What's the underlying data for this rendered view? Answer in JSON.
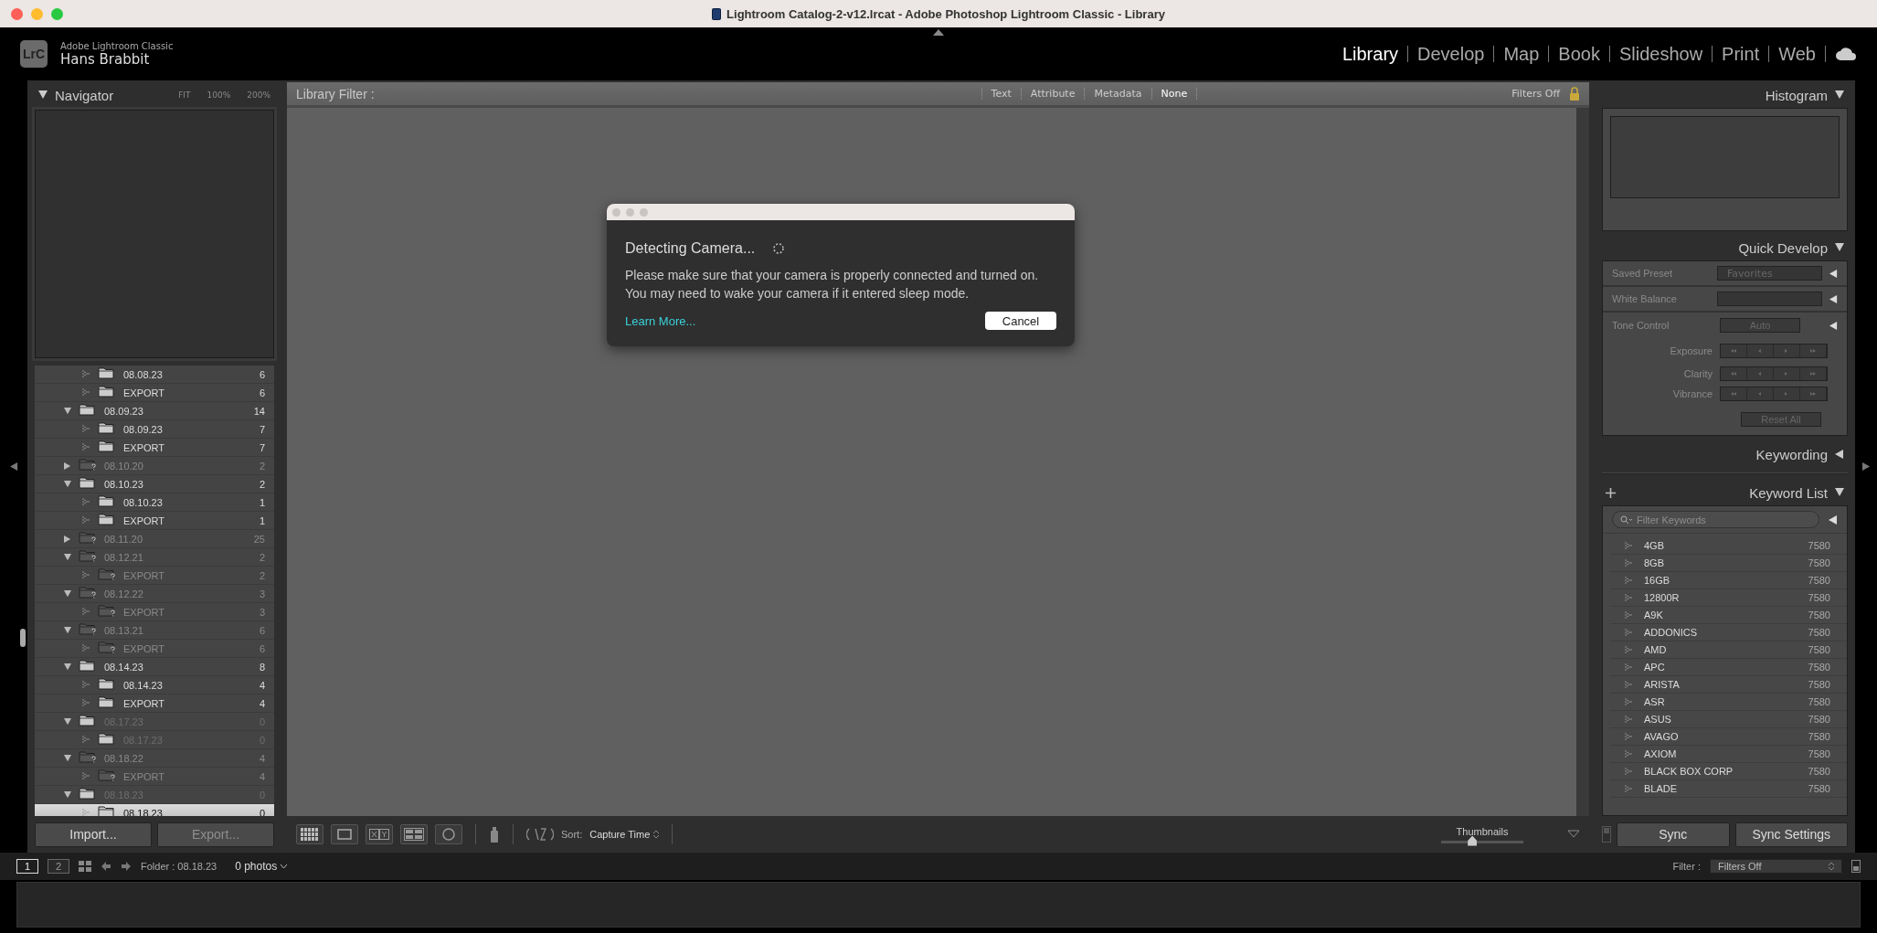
{
  "window": {
    "title": "Lightroom Catalog-2-v12.lrcat - Adobe Photoshop Lightroom Classic - Library"
  },
  "identity": {
    "logo": "LrC",
    "app": "Adobe Lightroom Classic",
    "user": "Hans Brabbit"
  },
  "modules": [
    {
      "label": "Library",
      "selected": true
    },
    {
      "label": "Develop",
      "selected": false
    },
    {
      "label": "Map",
      "selected": false
    },
    {
      "label": "Book",
      "selected": false
    },
    {
      "label": "Slideshow",
      "selected": false
    },
    {
      "label": "Print",
      "selected": false
    },
    {
      "label": "Web",
      "selected": false
    }
  ],
  "navigator": {
    "title": "Navigator",
    "expanded": true,
    "zoom_options": [
      "FIT",
      "100%",
      "200%"
    ]
  },
  "folders": {
    "partial_children": [
      {
        "label": "08.08.23",
        "count": "6",
        "missing": false,
        "empty": false,
        "selected": false
      },
      {
        "label": "EXPORT",
        "count": "6",
        "missing": false,
        "empty": false,
        "selected": false
      }
    ],
    "items": [
      {
        "label": "08.09.23",
        "count": "14",
        "expanded": true,
        "missing": false,
        "empty": false,
        "selected": false,
        "children": [
          {
            "label": "08.09.23",
            "count": "7",
            "missing": false,
            "empty": false,
            "selected": false
          },
          {
            "label": "EXPORT",
            "count": "7",
            "missing": false,
            "empty": false,
            "selected": false
          }
        ]
      },
      {
        "label": "08.10.20",
        "count": "2",
        "expanded": false,
        "missing": true,
        "empty": false,
        "selected": false
      },
      {
        "label": "08.10.23",
        "count": "2",
        "expanded": true,
        "missing": false,
        "empty": false,
        "selected": false,
        "children": [
          {
            "label": "08.10.23",
            "count": "1",
            "missing": false,
            "empty": false,
            "selected": false
          },
          {
            "label": "EXPORT",
            "count": "1",
            "missing": false,
            "empty": false,
            "selected": false
          }
        ]
      },
      {
        "label": "08.11.20",
        "count": "25",
        "expanded": false,
        "missing": true,
        "empty": false,
        "selected": false
      },
      {
        "label": "08.12.21",
        "count": "2",
        "expanded": true,
        "missing": true,
        "empty": false,
        "selected": false,
        "children": [
          {
            "label": "EXPORT",
            "count": "2",
            "missing": true,
            "empty": false,
            "selected": false
          }
        ]
      },
      {
        "label": "08.12.22",
        "count": "3",
        "expanded": true,
        "missing": true,
        "empty": false,
        "selected": false,
        "children": [
          {
            "label": "EXPORT",
            "count": "3",
            "missing": true,
            "empty": false,
            "selected": false
          }
        ]
      },
      {
        "label": "08.13.21",
        "count": "6",
        "expanded": true,
        "missing": true,
        "empty": false,
        "selected": false,
        "children": [
          {
            "label": "EXPORT",
            "count": "6",
            "missing": true,
            "empty": false,
            "selected": false
          }
        ]
      },
      {
        "label": "08.14.23",
        "count": "8",
        "expanded": true,
        "missing": false,
        "empty": false,
        "selected": false,
        "children": [
          {
            "label": "08.14.23",
            "count": "4",
            "missing": false,
            "empty": false,
            "selected": false
          },
          {
            "label": "EXPORT",
            "count": "4",
            "missing": false,
            "empty": false,
            "selected": false
          }
        ]
      },
      {
        "label": "08.17.23",
        "count": "0",
        "expanded": true,
        "missing": false,
        "empty": true,
        "selected": false,
        "children": [
          {
            "label": "08.17.23",
            "count": "0",
            "missing": false,
            "empty": true,
            "selected": false
          }
        ]
      },
      {
        "label": "08.18.22",
        "count": "4",
        "expanded": true,
        "missing": true,
        "empty": false,
        "selected": false,
        "children": [
          {
            "label": "EXPORT",
            "count": "4",
            "missing": true,
            "empty": false,
            "selected": false
          }
        ]
      },
      {
        "label": "08.18.23",
        "count": "0",
        "expanded": true,
        "missing": false,
        "empty": true,
        "selected": false,
        "children": [
          {
            "label": "08.18.23",
            "count": "0",
            "missing": false,
            "empty": false,
            "selected": true
          }
        ]
      }
    ]
  },
  "left_buttons": [
    {
      "label": "Import...",
      "disabled": false
    },
    {
      "label": "Export...",
      "disabled": true
    }
  ],
  "library_filter": {
    "label": "Library Filter :",
    "tabs": [
      {
        "label": "Text",
        "selected": false
      },
      {
        "label": "Attribute",
        "selected": false
      },
      {
        "label": "Metadata",
        "selected": false
      },
      {
        "label": "None",
        "selected": true
      }
    ],
    "preset": "Filters Off",
    "locked": true
  },
  "dialog": {
    "title": "Detecting Camera...",
    "message_lines": [
      "Please make sure that your camera is properly connected and turned on.",
      "You may need to wake your camera if it entered sleep mode."
    ],
    "link": "Learn More...",
    "button": "Cancel"
  },
  "toolbar": {
    "sort_label": "Sort:",
    "sort_value": "Capture Time",
    "thumbnails": {
      "label": "Thumbnails",
      "level": 0.38
    }
  },
  "histogram": {
    "title": "Histogram",
    "expanded": true
  },
  "quick_develop": {
    "title": "Quick Develop",
    "expanded": true,
    "saved_preset": {
      "label": "Saved Preset",
      "value": "Favorites"
    },
    "white_balance": {
      "label": "White Balance"
    },
    "tone_control": {
      "label": "Tone Control",
      "button": "Auto"
    },
    "adjustments": [
      "Exposure",
      "Clarity",
      "Vibrance"
    ],
    "reset": "Reset All"
  },
  "keywording": {
    "title": "Keywording",
    "expanded": false
  },
  "keyword_list": {
    "title": "Keyword List",
    "expanded": true,
    "placeholder": "Filter Keywords",
    "keywords": [
      {
        "name": "4GB",
        "count": "7580"
      },
      {
        "name": "8GB",
        "count": "7580"
      },
      {
        "name": "16GB",
        "count": "7580"
      },
      {
        "name": "12800R",
        "count": "7580"
      },
      {
        "name": "A9K",
        "count": "7580"
      },
      {
        "name": "ADDONICS",
        "count": "7580"
      },
      {
        "name": "AMD",
        "count": "7580"
      },
      {
        "name": "APC",
        "count": "7580"
      },
      {
        "name": "ARISTA",
        "count": "7580"
      },
      {
        "name": "ASR",
        "count": "7580"
      },
      {
        "name": "ASUS",
        "count": "7580"
      },
      {
        "name": "AVAGO",
        "count": "7580"
      },
      {
        "name": "AXIOM",
        "count": "7580"
      },
      {
        "name": "BLACK BOX CORP",
        "count": "7580"
      },
      {
        "name": "BLADE",
        "count": "7580"
      }
    ]
  },
  "sync_buttons": [
    "Sync",
    "Sync Settings"
  ],
  "filmstrip_bar": {
    "screens": [
      {
        "label": "1",
        "selected": true
      },
      {
        "label": "2",
        "selected": false
      }
    ],
    "source": "Folder : 08.18.23",
    "photo_count": "0 photos",
    "filter_label": "Filter :",
    "filter_value": "Filters Off"
  }
}
